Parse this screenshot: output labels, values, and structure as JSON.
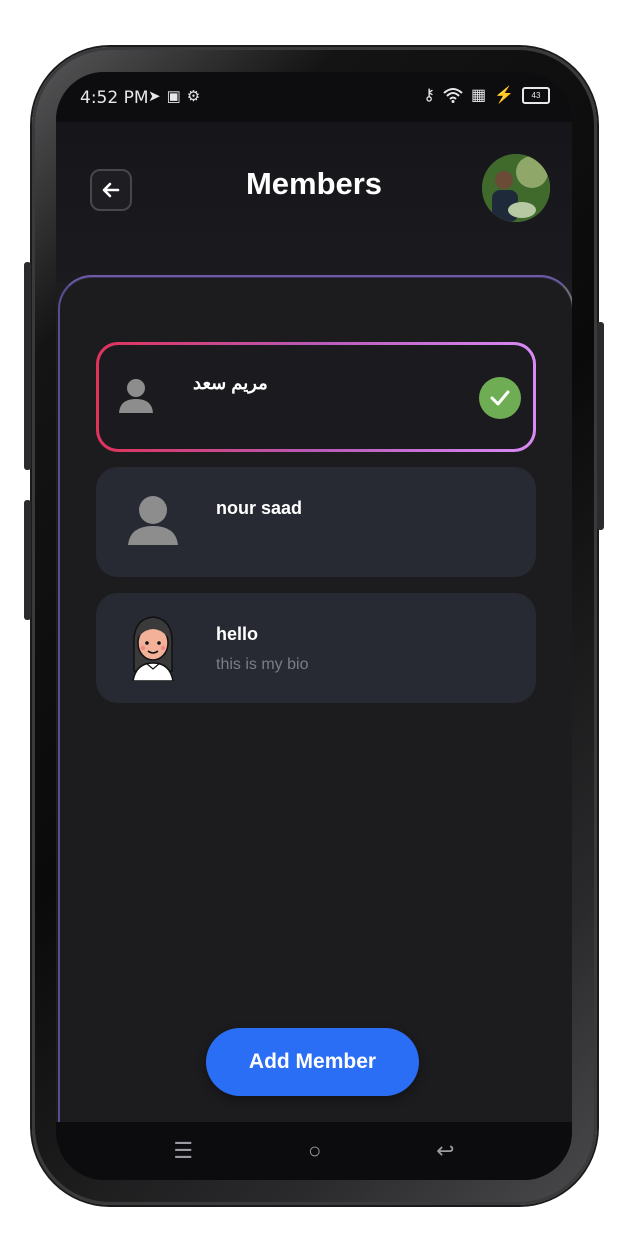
{
  "status_bar": {
    "time": "4:52 PM",
    "left_icons": [
      "telegram-icon",
      "app-icon",
      "settings-icon"
    ],
    "right_icons": [
      "key-icon",
      "wifi-icon",
      "signal-icon",
      "charging-icon",
      "battery-icon"
    ],
    "battery_level": "43"
  },
  "header": {
    "title": "Members",
    "back_icon": "arrow-left-icon",
    "avatar": "profile-avatar"
  },
  "members": [
    {
      "name": "مريم سعد",
      "bio": "",
      "avatar": "person-silhouette-icon",
      "selected": true
    },
    {
      "name": "nour saad",
      "bio": "",
      "avatar": "person-silhouette-icon",
      "selected": false
    },
    {
      "name": "hello",
      "bio": "this is my bio",
      "avatar": "girl-avatar-icon",
      "selected": false
    }
  ],
  "add_button": {
    "label": "Add Member"
  },
  "nav_bar": {
    "items": [
      "menu-icon",
      "home-icon",
      "back-icon"
    ]
  },
  "colors": {
    "accent": "#2a6ef5",
    "check": "#6fad55",
    "selected_gradient": [
      "#e0335a",
      "#d98af5"
    ],
    "background": "#1d1d20",
    "card_item": "#282a33"
  }
}
